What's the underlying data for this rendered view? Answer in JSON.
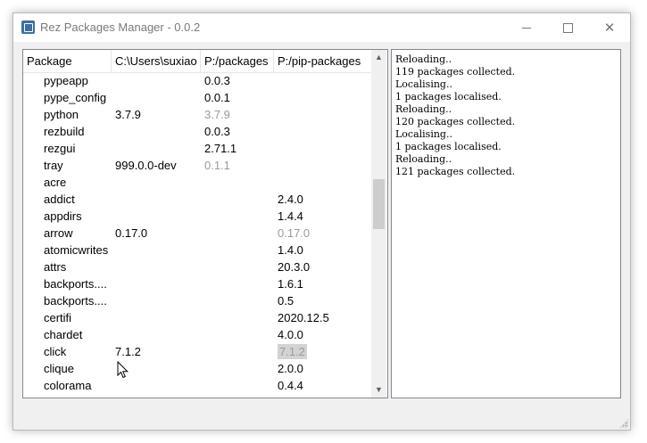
{
  "window": {
    "title": "Rez Packages Manager - 0.0.2",
    "controls": {
      "minimize": "minimize",
      "maximize": "maximize",
      "close": "✕"
    }
  },
  "table": {
    "headers": [
      "Package",
      "C:\\Users\\suxiao",
      "P:/packages",
      "P:/pip-packages"
    ],
    "rows": [
      {
        "name": "pypeapp",
        "user": "",
        "packages": "0.0.3",
        "pip": ""
      },
      {
        "name": "pype_config",
        "user": "",
        "packages": "0.0.1",
        "pip": ""
      },
      {
        "name": "python",
        "user": "3.7.9",
        "packages": "3.7.9",
        "pip": ""
      },
      {
        "name": "rezbuild",
        "user": "",
        "packages": "0.0.3",
        "pip": ""
      },
      {
        "name": "rezgui",
        "user": "",
        "packages": "2.71.1",
        "pip": ""
      },
      {
        "name": "tray",
        "user": "999.0.0-dev",
        "packages": "0.1.1",
        "pip": ""
      },
      {
        "name": "acre",
        "user": "",
        "packages": "",
        "pip": ""
      },
      {
        "name": "addict",
        "user": "",
        "packages": "",
        "pip": "2.4.0"
      },
      {
        "name": "appdirs",
        "user": "",
        "packages": "",
        "pip": "1.4.4"
      },
      {
        "name": "arrow",
        "user": "0.17.0",
        "packages": "",
        "pip": "0.17.0"
      },
      {
        "name": "atomicwrites",
        "user": "",
        "packages": "",
        "pip": "1.4.0"
      },
      {
        "name": "attrs",
        "user": "",
        "packages": "",
        "pip": "20.3.0"
      },
      {
        "name": "backports....",
        "user": "",
        "packages": "",
        "pip": "1.6.1"
      },
      {
        "name": "backports....",
        "user": "",
        "packages": "",
        "pip": "0.5"
      },
      {
        "name": "certifi",
        "user": "",
        "packages": "",
        "pip": "2020.12.5"
      },
      {
        "name": "chardet",
        "user": "",
        "packages": "",
        "pip": "4.0.0"
      },
      {
        "name": "click",
        "user": "7.1.2",
        "packages": "",
        "pip": "7.1.2"
      },
      {
        "name": "clique",
        "user": "",
        "packages": "",
        "pip": "2.0.0"
      },
      {
        "name": "colorama",
        "user": "",
        "packages": "",
        "pip": "0.4.4"
      }
    ]
  },
  "log": {
    "lines": [
      "Reloading..",
      "119 packages collected.",
      "Localising..",
      "1 packages localised.",
      "Reloading..",
      "120 packages collected.",
      "Localising..",
      "1 packages localised.",
      "Reloading..",
      "121 packages collected."
    ]
  },
  "colors": {
    "dim_text": "#9a9a9a",
    "highlight": "#d3d3d3",
    "border": "#828790"
  }
}
